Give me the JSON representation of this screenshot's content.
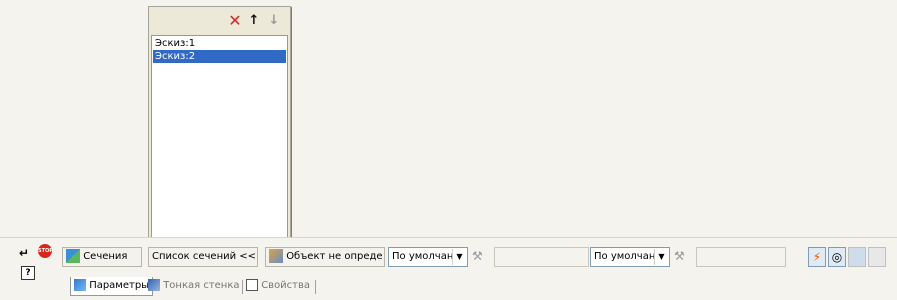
{
  "sections_popup": {
    "toolbar": {
      "delete_icon": "red-x-icon",
      "move_up_icon": "arrow-up-icon",
      "move_down_icon": "arrow-down-icon"
    },
    "items": [
      "Эскиз:1",
      "Эскиз:2"
    ],
    "selected_index": 1
  },
  "panel": {
    "sections_button": "Сечения",
    "sections_list_button": "Список сечений  <<",
    "object_field": "Объект не опреде",
    "dropdown1_value": "По умолчан",
    "dropdown2_value": "По умолчан",
    "tabs": [
      "Параметры",
      "Тонкая стенка",
      "Свойства"
    ]
  }
}
